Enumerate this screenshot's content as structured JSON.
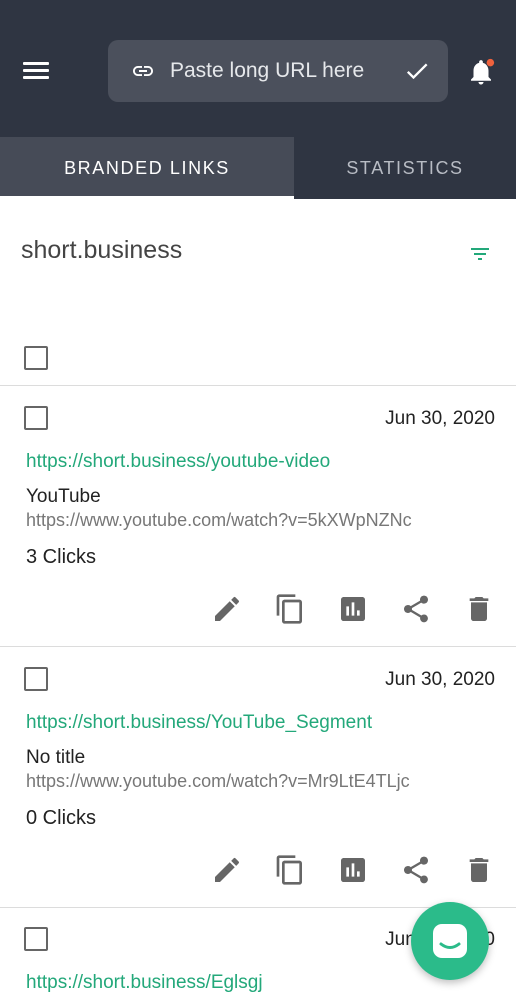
{
  "header": {
    "url_input": {
      "placeholder": "Paste long URL here",
      "value": ""
    },
    "notification_dot_color": "#f0623d",
    "icons": [
      "menu-icon",
      "link-icon",
      "check-icon",
      "bell-icon"
    ]
  },
  "tabs": [
    {
      "label": "BRANDED LINKS",
      "active": true
    },
    {
      "label": "STATISTICS",
      "active": false
    }
  ],
  "domain": {
    "name": "short.business"
  },
  "links": [
    {
      "date": "Jun 30, 2020",
      "short_url": "https://short.business/youtube-video",
      "title": "YouTube",
      "long_url": "https://www.youtube.com/watch?v=5kXWpNZNc",
      "clicks": "3 Clicks"
    },
    {
      "date": "Jun 30, 2020",
      "short_url": "https://short.business/YouTube_Segment",
      "title": "No title",
      "long_url": "https://www.youtube.com/watch?v=Mr9LtE4TLjc",
      "clicks": "0 Clicks"
    },
    {
      "date": "Jun 30, 2020",
      "short_url": "https://short.business/Eglsgj",
      "title": "",
      "long_url": "",
      "clicks": ""
    }
  ],
  "accent_color": "#23a87a",
  "action_icons": [
    "edit-icon",
    "copy-icon",
    "stats-icon",
    "share-icon",
    "delete-icon"
  ]
}
